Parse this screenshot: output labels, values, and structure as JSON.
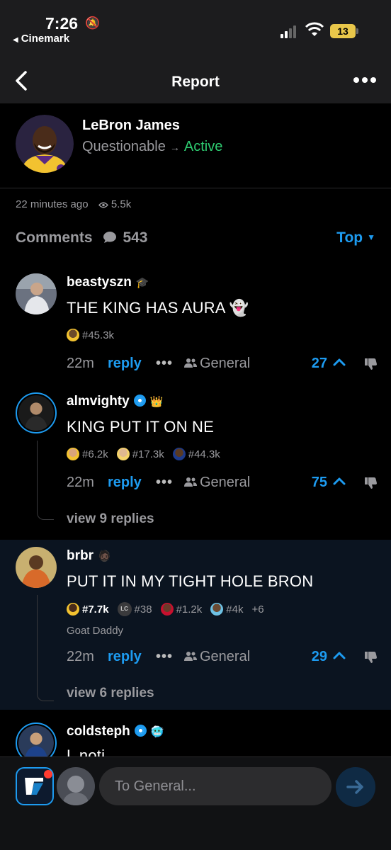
{
  "status_bar": {
    "time": "7:26",
    "carrier": "Cinemark",
    "battery": "13"
  },
  "nav": {
    "title": "Report"
  },
  "player": {
    "name": "LeBron James",
    "from_status": "Questionable",
    "to_status": "Active"
  },
  "meta": {
    "posted": "22 minutes ago",
    "views": "5.5k"
  },
  "comments_header": {
    "label": "Comments",
    "count": "543",
    "sort": "Top"
  },
  "comments": [
    {
      "user": "beastyszn",
      "text": "THE KING HAS AURA",
      "tags": [
        "#45.3k"
      ],
      "ago": "22m",
      "reply": "reply",
      "channel": "General",
      "votes": "27"
    },
    {
      "user": "almvighty",
      "text": "KING PUT IT ON NE",
      "tags": [
        "#6.2k",
        "#17.3k",
        "#44.3k"
      ],
      "ago": "22m",
      "reply": "reply",
      "channel": "General",
      "votes": "75",
      "view_replies": "view 9 replies"
    },
    {
      "user": "brbr",
      "text": "PUT IT IN MY TIGHT HOLE BRON",
      "tags": [
        "#7.7k",
        "LC",
        "#38",
        "#1.2k",
        "#4k",
        "+6"
      ],
      "flair": "Goat Daddy",
      "ago": "22m",
      "reply": "reply",
      "channel": "General",
      "votes": "29",
      "view_replies": "view 6 replies"
    },
    {
      "user": "coldsteph",
      "text": "L noti"
    }
  ],
  "compose": {
    "placeholder": "To General..."
  },
  "colors": {
    "accent": "#1d9bf0",
    "active": "#2ecc71",
    "muted": "#9a9a9e",
    "background": "#000000"
  },
  "icons": {
    "back": "chevron-left-icon",
    "more": "ellipsis-icon",
    "views": "eye-icon",
    "comments": "speech-bubble-icon",
    "upvote": "chevron-up-icon",
    "downvote": "thumbs-down-icon",
    "channel": "people-icon",
    "send": "arrow-right-icon"
  }
}
